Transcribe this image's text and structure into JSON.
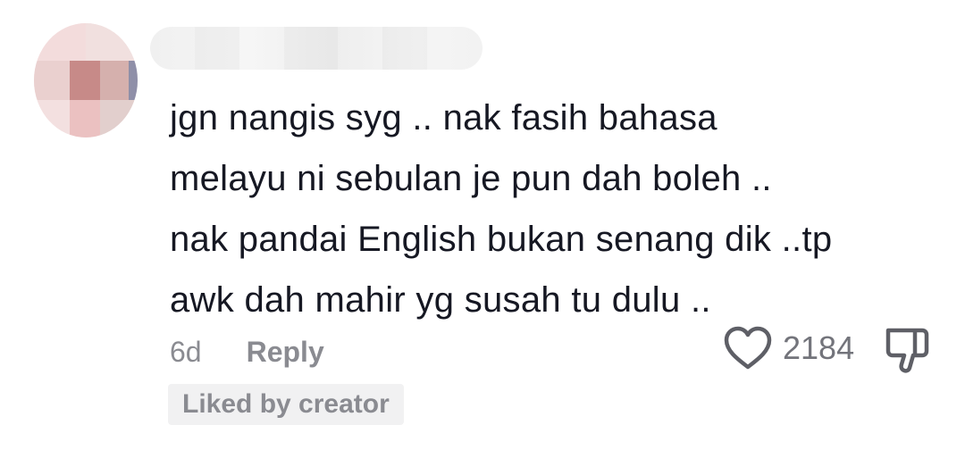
{
  "comment": {
    "avatar_icon": "user-avatar-blurred",
    "username_icon": "username-blurred",
    "text": "jgn nangis syg .. nak fasih bahasa\nmelayu ni sebulan je pun dah boleh ..\nnak pandai English bukan senang dik ..tp\nawk dah mahir yg susah tu dulu ..",
    "timestamp": "6d",
    "reply_label": "Reply",
    "like_icon": "heart-outline-icon",
    "like_count": "2184",
    "dislike_icon": "thumbs-down-icon",
    "liked_by_creator": "Liked by creator"
  },
  "colors": {
    "text": "#161823",
    "secondary": "#8a8b91",
    "badge_bg": "#f1f1f2",
    "icon": "#5e5f66"
  }
}
